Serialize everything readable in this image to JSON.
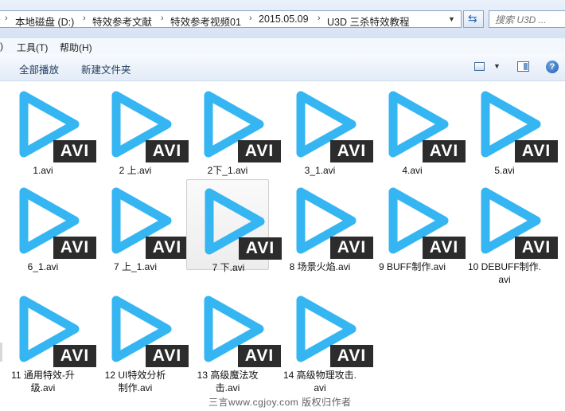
{
  "address": {
    "breadcrumbs": [
      "本地磁盘 (D:)",
      "特效参考文献",
      "特效参考视频01",
      "2015.05.09",
      "U3D  三杀特效教程"
    ],
    "separator": "›"
  },
  "search": {
    "placeholder": "搜索 U3D ..."
  },
  "menu": {
    "items": [
      ")",
      "工具(T)",
      "帮助(H)"
    ]
  },
  "toolbar": {
    "play_all": "全部播放",
    "new_folder": "新建文件夹"
  },
  "icons": {
    "refresh": "refresh-icon",
    "view": "view-options-icon",
    "preview_pane": "preview-pane-icon",
    "help": "help-icon",
    "file": "play-icon"
  },
  "colors": {
    "play_icon": "#35b6f3",
    "badge_bg": "#2c2c2c",
    "badge_text": "#ffffff"
  },
  "files": [
    {
      "lines": [
        "1.avi"
      ],
      "badge": "AVI"
    },
    {
      "lines": [
        "2 上.avi"
      ],
      "badge": "AVI"
    },
    {
      "lines": [
        "2下_1.avi"
      ],
      "badge": "AVI"
    },
    {
      "lines": [
        "3_1.avi"
      ],
      "badge": "AVI"
    },
    {
      "lines": [
        "4.avi"
      ],
      "badge": "AVI"
    },
    {
      "lines": [
        "5.avi"
      ],
      "badge": "AVI"
    },
    {
      "lines": [
        "6_1.avi"
      ],
      "badge": "AVI"
    },
    {
      "lines": [
        "7 上_1.avi"
      ],
      "badge": "AVI"
    },
    {
      "lines": [
        "7 下.avi"
      ],
      "badge": "AVI",
      "selected": true
    },
    {
      "lines": [
        "8 场景火焰.avi"
      ],
      "badge": "AVI"
    },
    {
      "lines": [
        "9 BUFF制作.avi"
      ],
      "badge": "AVI"
    },
    {
      "lines": [
        "10 DEBUFF制作.",
        "avi"
      ],
      "badge": "AVI"
    },
    {
      "lines": [
        "11 通用特效-升",
        "级.avi"
      ],
      "badge": "AVI"
    },
    {
      "lines": [
        "12 UI特效分析",
        "制作.avi"
      ],
      "badge": "AVI"
    },
    {
      "lines": [
        "13  高级魔法攻",
        "击.avi"
      ],
      "badge": "AVI"
    },
    {
      "lines": [
        "14 高级物理攻击.",
        "avi"
      ],
      "badge": "AVI"
    }
  ],
  "watermark": "三言www.cgjoy.com 版权归作者"
}
